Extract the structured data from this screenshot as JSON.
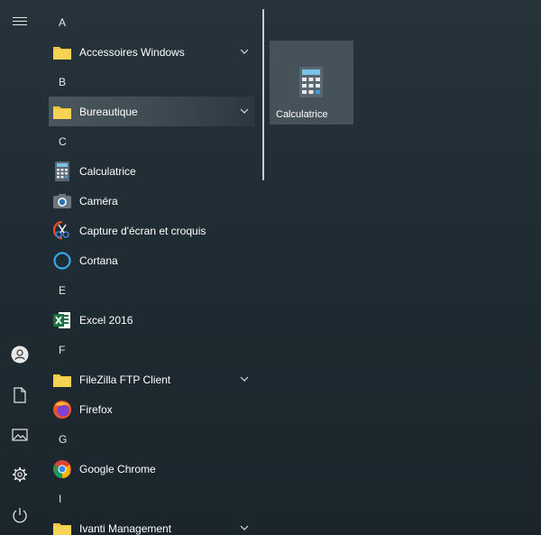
{
  "rail": {
    "items": [
      "hamburger-icon",
      "user-icon",
      "document-icon",
      "pictures-icon",
      "settings-icon",
      "power-icon"
    ]
  },
  "list": {
    "groups": [
      {
        "letter": "A",
        "apps": [
          {
            "label": "Accessoires Windows",
            "icon": "folder-icon",
            "expandable": true
          }
        ]
      },
      {
        "letter": "B",
        "apps": [
          {
            "label": "Bureautique",
            "icon": "folder-icon",
            "expandable": true,
            "selected": true
          }
        ]
      },
      {
        "letter": "C",
        "apps": [
          {
            "label": "Calculatrice",
            "icon": "calculator-icon"
          },
          {
            "label": "Caméra",
            "icon": "camera-icon"
          },
          {
            "label": "Capture d'écran et croquis",
            "icon": "snip-icon"
          },
          {
            "label": "Cortana",
            "icon": "cortana-icon"
          }
        ]
      },
      {
        "letter": "E",
        "apps": [
          {
            "label": "Excel 2016",
            "icon": "excel-icon"
          }
        ]
      },
      {
        "letter": "F",
        "apps": [
          {
            "label": "FileZilla FTP Client",
            "icon": "folder-icon",
            "expandable": true
          },
          {
            "label": "Firefox",
            "icon": "firefox-icon"
          }
        ]
      },
      {
        "letter": "G",
        "apps": [
          {
            "label": "Google Chrome",
            "icon": "chrome-icon"
          }
        ]
      },
      {
        "letter": "I",
        "apps": [
          {
            "label": "Ivanti Management",
            "icon": "folder-icon",
            "expandable": true
          }
        ]
      }
    ]
  },
  "tile": {
    "label": "Calculatrice",
    "icon": "calculator-icon",
    "color": "#46525a"
  },
  "colors": {
    "accent": "#4a565d",
    "background": "#1f2a31",
    "folder": "#f3c63d"
  }
}
